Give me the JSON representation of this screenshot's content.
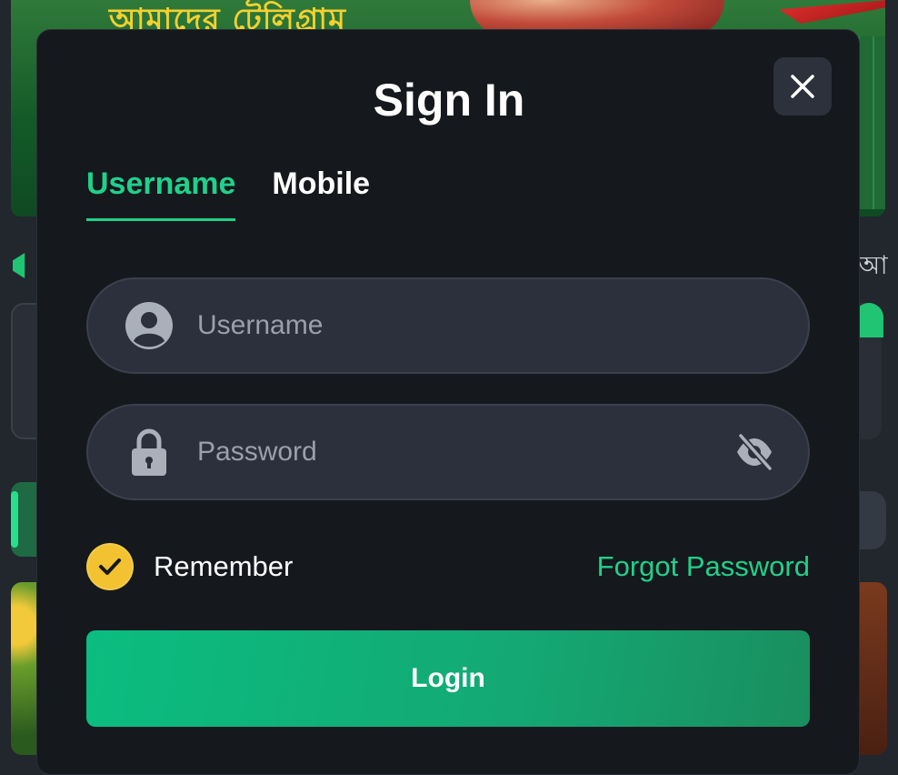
{
  "background": {
    "banner_text": "আমাদের টেলিগ্রাম",
    "right_edge_text": "আ"
  },
  "modal": {
    "title": "Sign In",
    "tabs": [
      {
        "label": "Username",
        "active": true
      },
      {
        "label": "Mobile",
        "active": false
      }
    ],
    "username_field": {
      "placeholder": "Username",
      "value": "",
      "icon": "user-icon"
    },
    "password_field": {
      "placeholder": "Password",
      "value": "",
      "icon": "lock-icon",
      "toggle_icon": "eye-off-icon"
    },
    "remember": {
      "label": "Remember",
      "checked": true
    },
    "forgot_password_label": "Forgot Password",
    "login_label": "Login"
  },
  "colors": {
    "accent": "#1fd18a",
    "modal_bg": "#15181d",
    "field_bg": "#2c303c",
    "checkbox": "#f2c230",
    "login_button": "#0bbd80"
  }
}
